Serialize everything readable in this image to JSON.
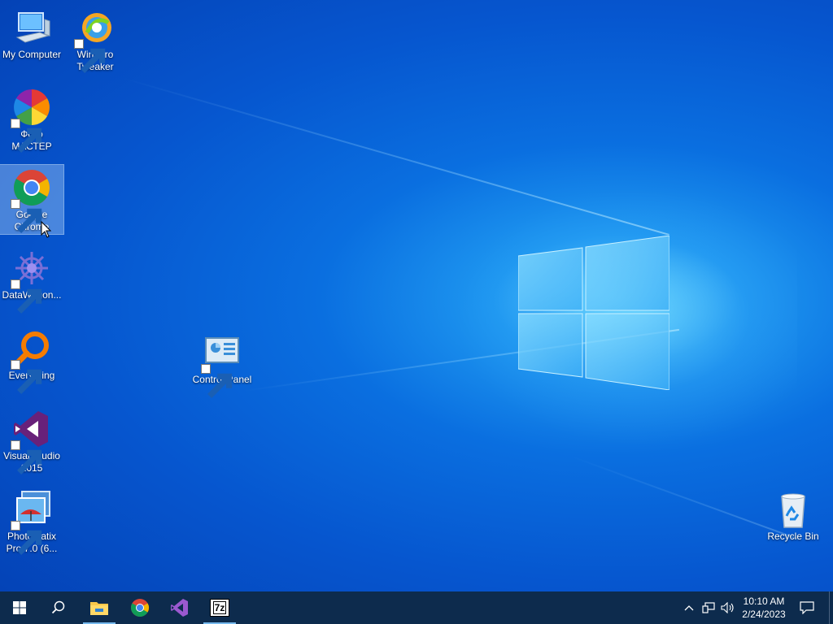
{
  "desktop": {
    "icons": [
      {
        "label_line1": "My Computer",
        "label_line2": ""
      },
      {
        "label_line1": "Winaero",
        "label_line2": "Tweaker"
      },
      {
        "label_line1": "Фото",
        "label_line2": "МАСТЕР"
      },
      {
        "label_line1": "Google",
        "label_line2": "Chrome"
      },
      {
        "label_line1": "DataWagon...",
        "label_line2": ""
      },
      {
        "label_line1": "Everything",
        "label_line2": ""
      },
      {
        "label_line1": "Control Panel",
        "label_line2": ""
      },
      {
        "label_line1": "Visual Studio",
        "label_line2": "2015"
      },
      {
        "label_line1": "Photomatix",
        "label_line2": "Pro 7.0 (6..."
      },
      {
        "label_line1": "Recycle Bin",
        "label_line2": ""
      }
    ],
    "selected_icon": "Google Chrome"
  },
  "taskbar": {
    "pinned": [
      {
        "icon": "windows-start-icon"
      },
      {
        "icon": "search-icon"
      },
      {
        "icon": "file-explorer-icon"
      },
      {
        "icon": "chrome-icon"
      },
      {
        "icon": "visual-studio-icon"
      },
      {
        "icon": "7zip-icon",
        "label": "7z"
      }
    ],
    "tray": {
      "icons": [
        "chevron-up-icon",
        "network-icon",
        "volume-icon"
      ],
      "time": "10:10 AM",
      "date": "2/24/2023"
    }
  },
  "colors": {
    "taskbar_bg": "#0d2b4d",
    "desktop_blue": "#0656cf",
    "active_indicator": "#76b9ed"
  }
}
